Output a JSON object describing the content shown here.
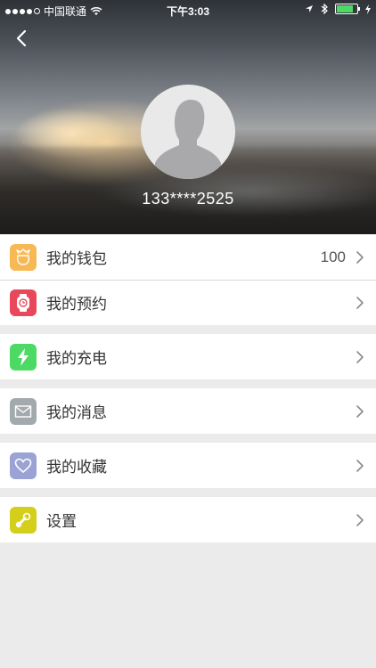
{
  "status": {
    "carrier": "中国联通",
    "time": "下午3:03"
  },
  "profile": {
    "phone": "133****2525"
  },
  "menu": {
    "wallet": {
      "label": "我的钱包",
      "value": "100",
      "color": "#f7b955"
    },
    "booking": {
      "label": "我的预约",
      "color": "#e8485a"
    },
    "charge": {
      "label": "我的充电",
      "color": "#4cd964"
    },
    "messages": {
      "label": "我的消息",
      "color": "#a3aaae"
    },
    "favorites": {
      "label": "我的收藏",
      "color": "#9aa3d4"
    },
    "settings": {
      "label": "设置",
      "color": "#d4cf1a"
    }
  }
}
